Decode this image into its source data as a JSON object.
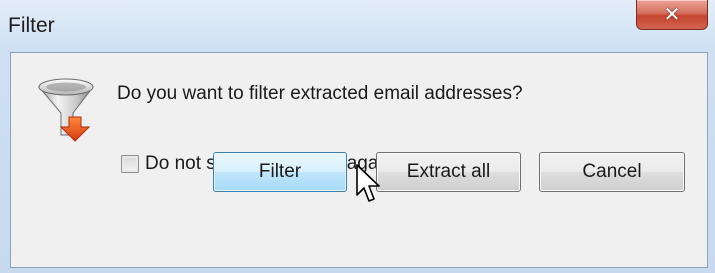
{
  "window": {
    "title": "Filter",
    "close_glyph": "✕"
  },
  "dialog": {
    "icon": "funnel-download-icon",
    "message": "Do you want to filter extracted email addresses?",
    "checkbox": {
      "label": "Do not show this dialog again",
      "checked": false
    },
    "buttons": {
      "filter": "Filter",
      "extract_all": "Extract all",
      "cancel": "Cancel"
    }
  },
  "colors": {
    "close_red": "#c5442f",
    "primary_button_blue": "#bee6fd",
    "arrow_orange": "#e8501c"
  }
}
